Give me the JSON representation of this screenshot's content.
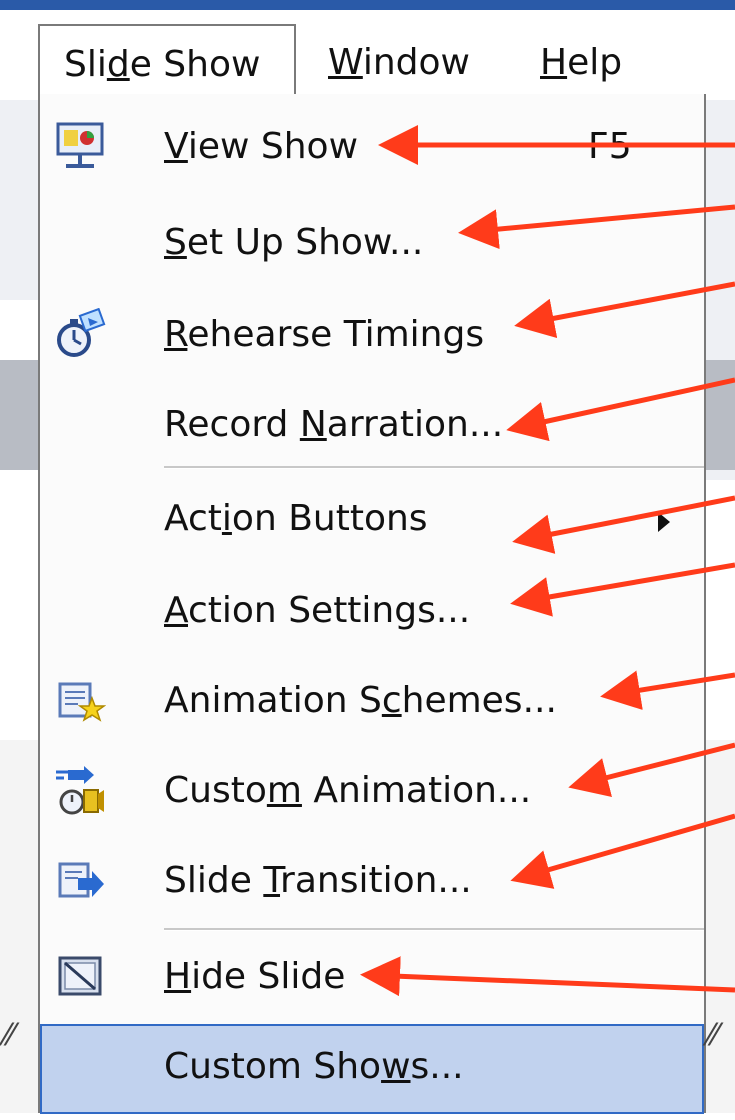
{
  "menubar": {
    "items": [
      {
        "pre": "Sli",
        "u": "d",
        "post": "e Show"
      },
      {
        "pre": "",
        "u": "W",
        "post": "indow"
      },
      {
        "pre": "",
        "u": "H",
        "post": "elp"
      }
    ]
  },
  "menu": {
    "items": [
      {
        "pre": "",
        "u": "V",
        "post": "iew Show",
        "shortcut": "F5",
        "icon": "projector-screen-icon"
      },
      {
        "pre": "",
        "u": "S",
        "post": "et Up Show...",
        "shortcut": "",
        "icon": ""
      },
      {
        "pre": "",
        "u": "R",
        "post": "ehearse Timings",
        "shortcut": "",
        "icon": "stopwatch-icon"
      },
      {
        "pre": "Record ",
        "u": "N",
        "post": "arration...",
        "shortcut": "",
        "icon": ""
      },
      {
        "pre": "Act",
        "u": "i",
        "post": "on Buttons",
        "shortcut": "",
        "icon": "",
        "submenu": true
      },
      {
        "pre": "",
        "u": "A",
        "post": "ction Settings...",
        "shortcut": "",
        "icon": ""
      },
      {
        "pre": "Animation S",
        "u": "c",
        "post": "hemes...",
        "shortcut": "",
        "icon": "animation-schemes-icon"
      },
      {
        "pre": "Custo",
        "u": "m",
        "post": " Animation...",
        "shortcut": "",
        "icon": "custom-animation-icon"
      },
      {
        "pre": "Slide ",
        "u": "T",
        "post": "ransition...",
        "shortcut": "",
        "icon": "slide-transition-icon"
      },
      {
        "pre": "",
        "u": "H",
        "post": "ide Slide",
        "shortcut": "",
        "icon": "hide-slide-icon"
      },
      {
        "pre": "Custom Sho",
        "u": "w",
        "post": "s...",
        "shortcut": "",
        "icon": "",
        "selected": true
      }
    ]
  },
  "colors": {
    "arrow": "#ff3b1a",
    "highlight": "#c1d2ee",
    "highlight_border": "#316ac5"
  }
}
